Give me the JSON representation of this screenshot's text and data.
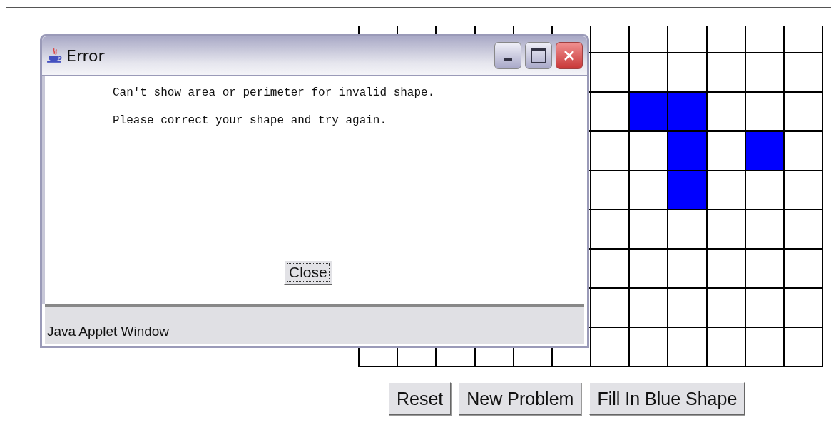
{
  "grid": {
    "rows": [
      [
        false,
        false,
        false,
        false,
        false,
        false,
        false,
        false,
        false,
        false,
        false,
        false
      ],
      [
        false,
        false,
        false,
        false,
        false,
        false
      ],
      [
        false,
        true,
        true,
        false,
        false,
        false
      ],
      [
        false,
        false,
        true,
        false,
        true,
        false
      ],
      [
        false,
        false,
        true,
        false,
        false,
        false
      ],
      [
        false,
        false,
        false,
        false,
        false,
        false
      ],
      [
        false,
        false,
        false,
        false,
        false,
        false
      ],
      [
        false,
        false,
        false,
        false,
        false,
        false
      ],
      [
        false,
        false,
        false,
        false,
        false,
        false,
        false,
        false,
        false,
        false,
        false,
        false
      ]
    ]
  },
  "buttons": [
    "Reset",
    "New Problem",
    "Fill In Blue Shape"
  ],
  "dialog": {
    "title": "Error",
    "messages": [
      "Can't show area or perimeter for invalid shape.",
      "Please correct your shape and try again."
    ],
    "button": "Close",
    "status_bar": "Java Applet Window"
  }
}
